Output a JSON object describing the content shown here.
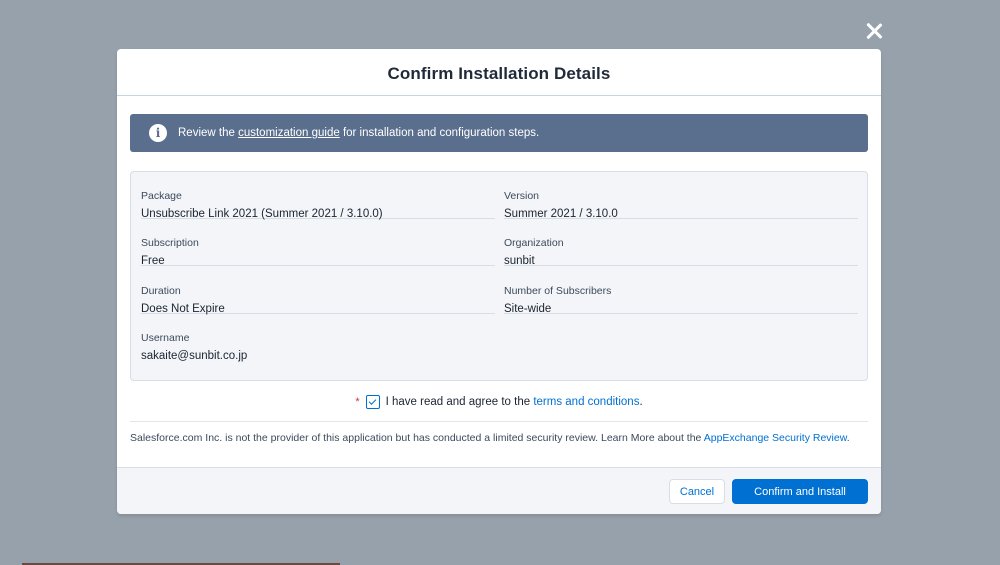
{
  "modal": {
    "title": "Confirm Installation Details",
    "close_icon": "close-icon"
  },
  "banner": {
    "icon": "info-icon",
    "icon_glyph": "i",
    "text_before": "Review the ",
    "link_text": "customization guide",
    "text_after": " for installation and configuration steps."
  },
  "details": {
    "package": {
      "label": "Package",
      "value": "Unsubscribe Link 2021 (Summer 2021 / 3.10.0)"
    },
    "version": {
      "label": "Version",
      "value": "Summer 2021 / 3.10.0"
    },
    "subscription": {
      "label": "Subscription",
      "value": "Free"
    },
    "organization": {
      "label": "Organization",
      "value": "sunbit"
    },
    "duration": {
      "label": "Duration",
      "value": "Does Not Expire"
    },
    "subscribers": {
      "label": "Number of Subscribers",
      "value": "Site-wide"
    },
    "username": {
      "label": "Username",
      "value": "sakaite@sunbit.co.jp"
    }
  },
  "agreement": {
    "required_mark": "*",
    "checked": true,
    "text": "I have read and agree to the ",
    "link_text": "terms and conditions",
    "suffix": "."
  },
  "disclaimer": {
    "text": "Salesforce.com Inc. is not the provider of this application but has conducted a limited security review. Learn More about the ",
    "link_text": "AppExchange Security Review",
    "suffix": "."
  },
  "footer": {
    "cancel_label": "Cancel",
    "confirm_label": "Confirm and Install"
  },
  "colors": {
    "overlay": "#97a1ab",
    "banner": "#5a6f8e",
    "primary": "#0070d2",
    "required": "#c23934"
  }
}
